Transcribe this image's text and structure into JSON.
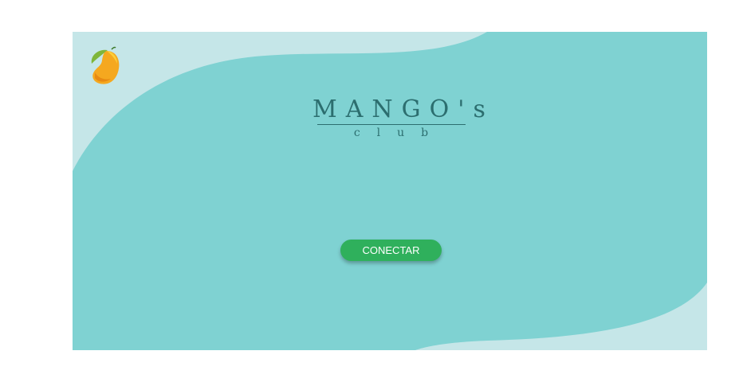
{
  "colors": {
    "page_background": "#ffffff",
    "frame_background": "#c5e6e8",
    "wave_fill": "#7fd2d2",
    "brand_text": "#2c6e6f",
    "button_background": "#2fb05c",
    "button_text": "#ffffff"
  },
  "logo": {
    "icon": "mango-icon"
  },
  "brand": {
    "title": "MANGO's",
    "subtitle": "club"
  },
  "connect_button": {
    "label": "CONECTAR"
  }
}
